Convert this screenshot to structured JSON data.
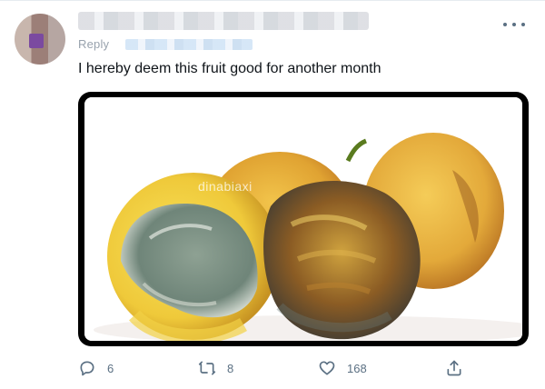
{
  "tweet": {
    "reply_prefix": "Reply",
    "text": "I hereby deem this fruit good for another month",
    "more_icon": "more-horizontal-icon"
  },
  "media": {
    "watermark": "dinabiaxi"
  },
  "actions": {
    "reply_count": "6",
    "retweet_count": "8",
    "like_count": "168",
    "icons": [
      "reply-icon",
      "retweet-icon",
      "like-icon",
      "share-icon"
    ]
  },
  "colors": {
    "text": "#0f1419",
    "secondary": "#5b7083",
    "divider": "#e6ecf0"
  }
}
